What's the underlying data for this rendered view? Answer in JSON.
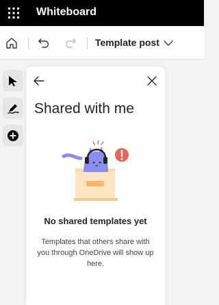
{
  "app": {
    "title": "Whiteboard"
  },
  "toolbar": {
    "document_title": "Template post",
    "icons": [
      "home-icon",
      "undo-icon",
      "redo-icon",
      "chevron-down-icon"
    ]
  },
  "rail": {
    "tools": [
      {
        "name": "select",
        "icon": "cursor-arrow-icon",
        "active": true
      },
      {
        "name": "pen",
        "icon": "pen-icon",
        "active": false
      },
      {
        "name": "add",
        "icon": "plus-circle-icon",
        "active": false
      }
    ]
  },
  "panel": {
    "title": "Shared with me",
    "empty_title": "No shared templates yet",
    "empty_description": "Templates that others share with you through OneDrive will show up here."
  },
  "colors": {
    "titlebar": "#000000",
    "accent_purple": "#8b8cf0",
    "box_orange": "#fcd9a8",
    "alert_red": "#e8655a"
  }
}
